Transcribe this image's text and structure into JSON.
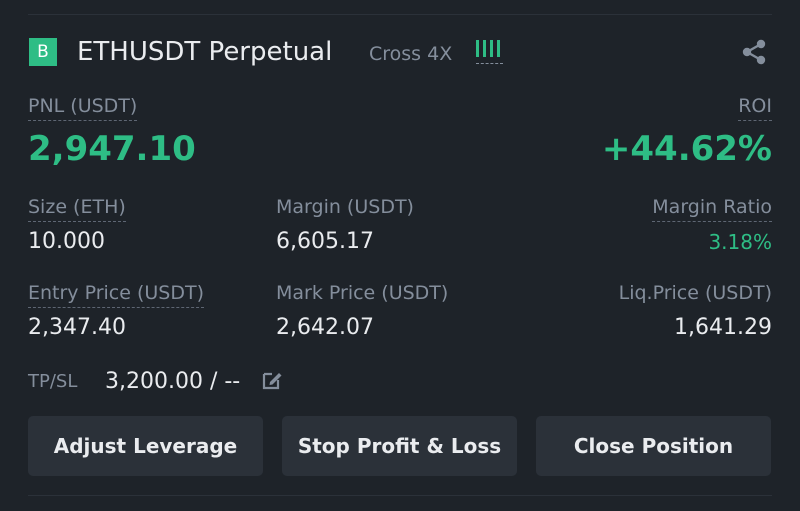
{
  "position": {
    "badge": "B",
    "symbol": "ETHUSDT Perpetual",
    "margin_mode": "Cross 4X",
    "signal_icon": "signal-bars-icon",
    "share_icon": "share-icon"
  },
  "pnl": {
    "label": "PNL (USDT)",
    "value": "2,947.10"
  },
  "roi": {
    "label": "ROI",
    "value": "+44.62%"
  },
  "size": {
    "label": "Size (ETH)",
    "value": "10.000"
  },
  "margin": {
    "label": "Margin (USDT)",
    "value": "6,605.17"
  },
  "margin_ratio": {
    "label": "Margin Ratio",
    "value": "3.18%"
  },
  "entry_price": {
    "label": "Entry Price (USDT)",
    "value": "2,347.40"
  },
  "mark_price": {
    "label": "Mark Price (USDT)",
    "value": "2,642.07"
  },
  "liq_price": {
    "label": "Liq.Price (USDT)",
    "value": "1,641.29"
  },
  "tpsl": {
    "label": "TP/SL",
    "value": "3,200.00 / --",
    "edit_icon": "edit-icon"
  },
  "actions": {
    "adjust_leverage": "Adjust Leverage",
    "stop_profit_loss": "Stop Profit & Loss",
    "close_position": "Close Position"
  },
  "colors": {
    "background": "#1e2329",
    "positive": "#2ebd85",
    "text_primary": "#eaecef",
    "text_secondary": "#848e9c",
    "button_bg": "#2b3139"
  }
}
